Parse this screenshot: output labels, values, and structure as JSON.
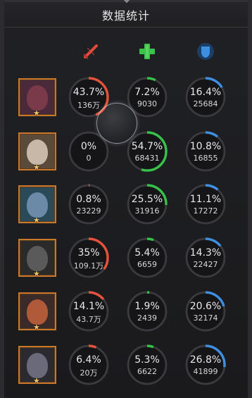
{
  "title": "数据统计",
  "header_icons": [
    {
      "name": "damage-sword-icon",
      "color": "#e04a3a"
    },
    {
      "name": "heal-cross-icon",
      "color": "#3ac24a"
    },
    {
      "name": "shield-icon",
      "color": "#3a8ee0"
    }
  ],
  "colors": {
    "damage": "#e2533d",
    "heal": "#38c04a",
    "shield": "#3f8fe0"
  },
  "rows": [
    {
      "portrait": "portrait-hero-1",
      "stats": [
        {
          "pct": "43.7%",
          "value": "136万",
          "fill": 0.437
        },
        {
          "pct": "7.2%",
          "value": "9030",
          "fill": 0.072
        },
        {
          "pct": "16.4%",
          "value": "25684",
          "fill": 0.164
        }
      ]
    },
    {
      "portrait": "portrait-hero-2",
      "stats": [
        {
          "pct": "0%",
          "value": "0",
          "fill": 0
        },
        {
          "pct": "54.7%",
          "value": "68431",
          "fill": 0.547
        },
        {
          "pct": "10.8%",
          "value": "16855",
          "fill": 0.108
        }
      ]
    },
    {
      "portrait": "portrait-hero-3",
      "stats": [
        {
          "pct": "0.8%",
          "value": "23229",
          "fill": 0.008
        },
        {
          "pct": "25.5%",
          "value": "31916",
          "fill": 0.255
        },
        {
          "pct": "11.1%",
          "value": "17272",
          "fill": 0.111
        }
      ]
    },
    {
      "portrait": "portrait-hero-4",
      "stats": [
        {
          "pct": "35%",
          "value": "109.1万",
          "fill": 0.35
        },
        {
          "pct": "5.4%",
          "value": "6659",
          "fill": 0.054
        },
        {
          "pct": "14.3%",
          "value": "22427",
          "fill": 0.143
        }
      ]
    },
    {
      "portrait": "portrait-hero-5",
      "stats": [
        {
          "pct": "14.1%",
          "value": "43.7万",
          "fill": 0.141
        },
        {
          "pct": "1.9%",
          "value": "2439",
          "fill": 0.019
        },
        {
          "pct": "20.6%",
          "value": "32174",
          "fill": 0.206
        }
      ]
    },
    {
      "portrait": "portrait-hero-6",
      "stats": [
        {
          "pct": "6.4%",
          "value": "20万",
          "fill": 0.064
        },
        {
          "pct": "5.3%",
          "value": "6622",
          "fill": 0.053
        },
        {
          "pct": "26.8%",
          "value": "41899",
          "fill": 0.268
        }
      ]
    }
  ]
}
